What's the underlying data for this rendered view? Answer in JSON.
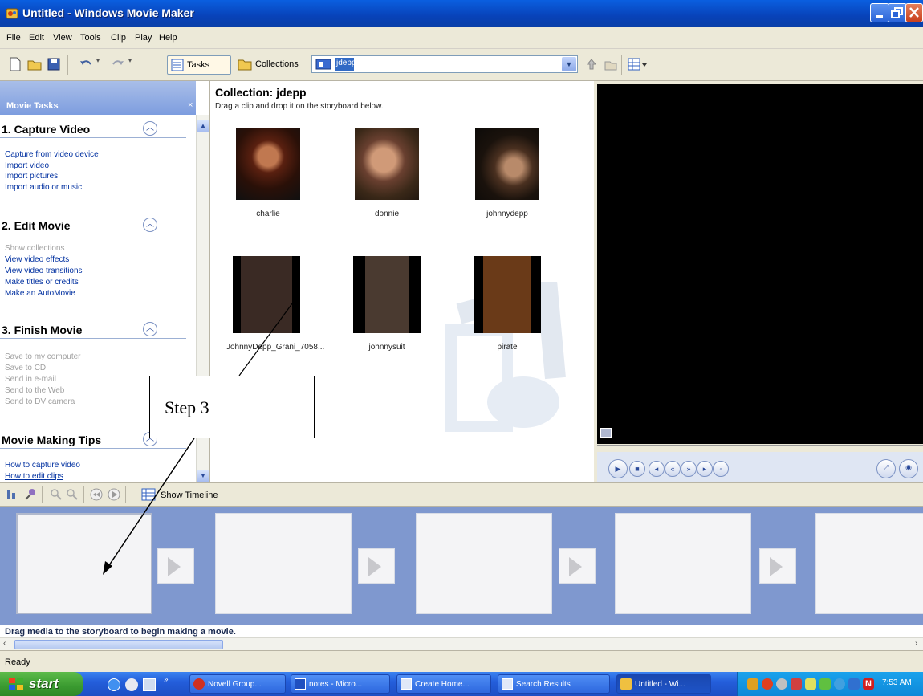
{
  "window": {
    "title": "Untitled - Windows Movie Maker"
  },
  "menu": [
    "File",
    "Edit",
    "View",
    "Tools",
    "Clip",
    "Play",
    "Help"
  ],
  "toolbar": {
    "tasks_label": "Tasks",
    "collections_label": "Collections",
    "collection_combo_value": "jdepp"
  },
  "task_pane": {
    "header": "Movie Tasks",
    "close_glyph": "×",
    "sections": [
      {
        "title": "1. Capture Video",
        "links": [
          {
            "label": "Capture from video device",
            "enabled": true
          },
          {
            "label": "Import video",
            "enabled": true
          },
          {
            "label": "Import pictures",
            "enabled": true
          },
          {
            "label": "Import audio or music",
            "enabled": true
          }
        ]
      },
      {
        "title": "2. Edit Movie",
        "links": [
          {
            "label": "Show collections",
            "enabled": false
          },
          {
            "label": "View video effects",
            "enabled": true
          },
          {
            "label": "View video transitions",
            "enabled": true
          },
          {
            "label": "Make titles or credits",
            "enabled": true
          },
          {
            "label": "Make an AutoMovie",
            "enabled": true
          }
        ]
      },
      {
        "title": "3. Finish Movie",
        "links": [
          {
            "label": "Save to my computer",
            "enabled": false
          },
          {
            "label": "Save to CD",
            "enabled": false
          },
          {
            "label": "Send in e-mail",
            "enabled": false
          },
          {
            "label": "Send to the Web",
            "enabled": false
          },
          {
            "label": "Send to DV camera",
            "enabled": false
          }
        ]
      },
      {
        "title": "Movie Making Tips",
        "links": [
          {
            "label": "How to capture video",
            "enabled": true
          },
          {
            "label": "How to edit clips",
            "enabled": true
          }
        ]
      }
    ]
  },
  "collection": {
    "title": "Collection: jdepp",
    "subtitle": "Drag a clip and drop it on the storyboard below.",
    "clips": [
      "charlie",
      "donnie",
      "johnnydepp",
      "JohnnyDepp_Grani_7058...",
      "johnnysuit",
      "pirate"
    ]
  },
  "storyboard": {
    "show_timeline_label": "Show Timeline",
    "message": "Drag media to the storyboard to begin making a movie."
  },
  "status": {
    "text": "Ready"
  },
  "annotation": {
    "label": "Step 3"
  },
  "taskbar": {
    "start_label": "start",
    "items": [
      "Novell Group...",
      "notes - Micro...",
      "Create Home...",
      "Search Results",
      "Untitled - Wi..."
    ],
    "clock": "7:53 AM"
  }
}
